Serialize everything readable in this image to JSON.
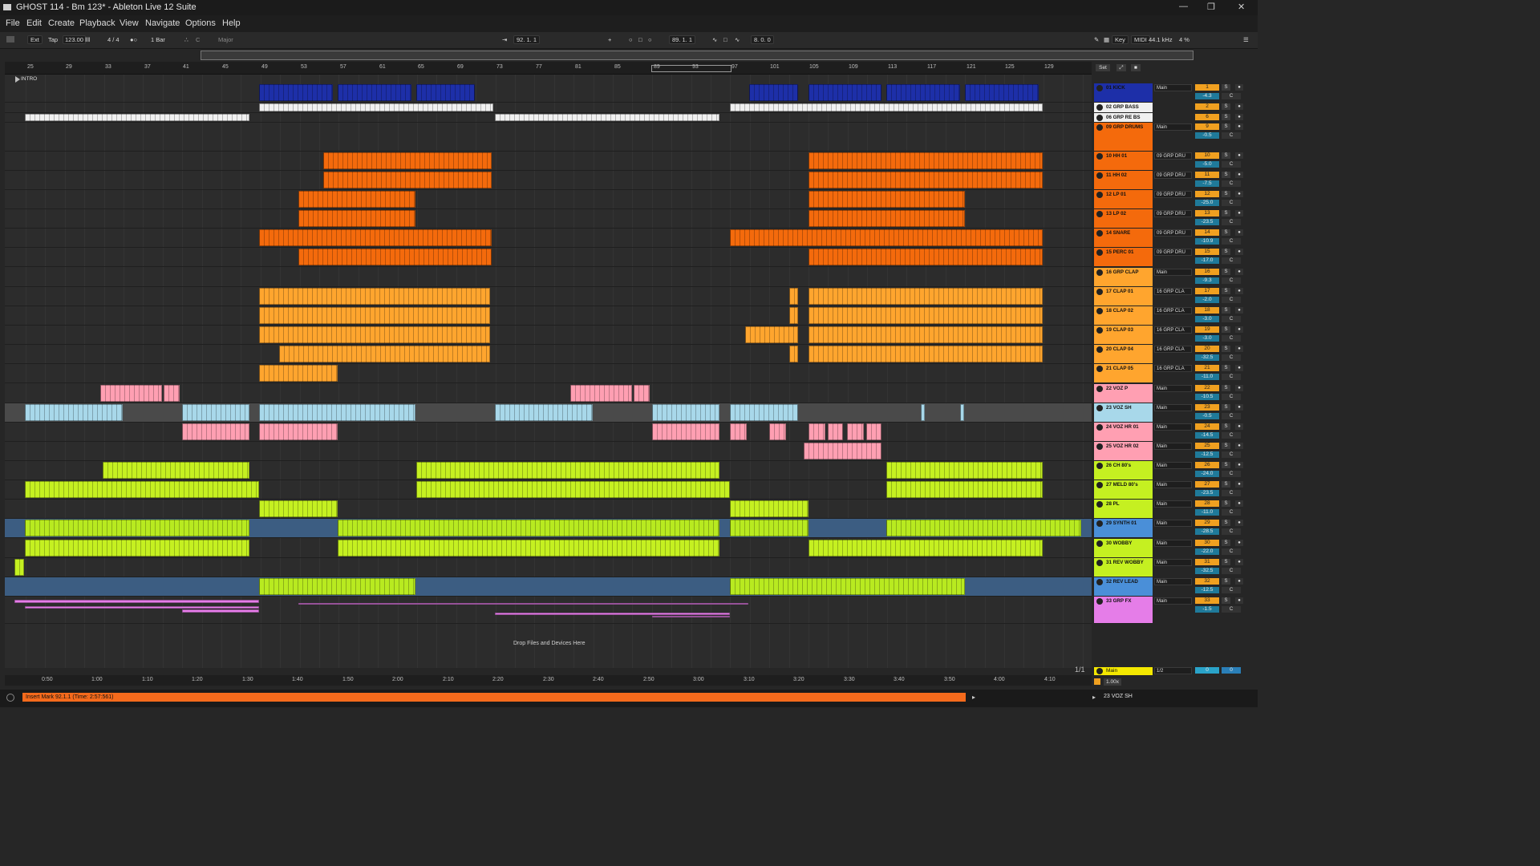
{
  "window": {
    "title": "GHOST 114 - Bm 123* - Ableton Live 12 Suite"
  },
  "menu": [
    "File",
    "Edit",
    "Create",
    "View",
    "Playback",
    "Navigate",
    "Options",
    "Help"
  ],
  "control": {
    "ext": "Ext",
    "tap": "Tap",
    "tempo": "123.00",
    "meter": "4 / 4",
    "quant": "1 Bar",
    "key": "C",
    "scale": "Major",
    "arr_pos": "92.  1.  1",
    "punch": "89.  1.  1",
    "loop_len": "8.  0.  0",
    "key_label": "Key",
    "midi_label": "MIDI",
    "sample_rate": "44.1 kHz",
    "cpu": "4 %"
  },
  "ruler": {
    "bars": [
      "25",
      "29",
      "33",
      "37",
      "41",
      "45",
      "49",
      "53",
      "57",
      "61",
      "65",
      "69",
      "73",
      "77",
      "81",
      "85",
      "89",
      "93",
      "97",
      "101",
      "105",
      "109",
      "113",
      "117",
      "121",
      "125",
      "129"
    ],
    "locator": "INTRO"
  },
  "timeline": {
    "times": [
      "0:50",
      "1:00",
      "1:10",
      "1:20",
      "1:30",
      "1:40",
      "1:50",
      "2:00",
      "2:10",
      "2:20",
      "2:30",
      "2:40",
      "2:50",
      "3:00",
      "3:10",
      "3:20",
      "3:30",
      "3:40",
      "3:50",
      "4:00",
      "4:10"
    ]
  },
  "tracks": [
    {
      "name": "01 KICK",
      "io": "Main",
      "num": "1",
      "vol": "-4.3",
      "color": "#1d2fa8"
    },
    {
      "name": "02 GRP BASS",
      "io": "",
      "num": "2",
      "vol": "",
      "color": "#f0f0f0"
    },
    {
      "name": "06 GRP RE BS",
      "io": "",
      "num": "6",
      "vol": "",
      "color": "#f0f0f0"
    },
    {
      "name": "09 GRP DRUMS",
      "io": "Main",
      "num": "9",
      "vol": "-0.5",
      "color": "#f46a0c"
    },
    {
      "name": "10 HH 01",
      "io": "09 GRP DRU",
      "num": "10",
      "vol": "-5.0",
      "color": "#f46a0c"
    },
    {
      "name": "11 HH 02",
      "io": "09 GRP DRU",
      "num": "11",
      "vol": "-7.5",
      "color": "#f46a0c"
    },
    {
      "name": "12 LP 01",
      "io": "09 GRP DRU",
      "num": "12",
      "vol": "-25.0",
      "color": "#f46a0c"
    },
    {
      "name": "13 LP 02",
      "io": "09 GRP DRU",
      "num": "13",
      "vol": "-23.5",
      "color": "#f46a0c"
    },
    {
      "name": "14 SNARE",
      "io": "09 GRP DRU",
      "num": "14",
      "vol": "-10.9",
      "color": "#f46a0c"
    },
    {
      "name": "15 PERC 01",
      "io": "09 GRP DRU",
      "num": "15",
      "vol": "-17.0",
      "color": "#f46a0c"
    },
    {
      "name": "16 GRP CLAP",
      "io": "Main",
      "num": "16",
      "vol": "-9.3",
      "color": "#ffa52e"
    },
    {
      "name": "17 CLAP 01",
      "io": "16 GRP CLA",
      "num": "17",
      "vol": "-2.0",
      "color": "#ffa52e"
    },
    {
      "name": "18 CLAP 02",
      "io": "16 GRP CLA",
      "num": "18",
      "vol": "-3.0",
      "color": "#ffa52e"
    },
    {
      "name": "19 CLAP 03",
      "io": "16 GRP CLA",
      "num": "19",
      "vol": "-3.0",
      "color": "#ffa52e"
    },
    {
      "name": "20 CLAP 04",
      "io": "16 GRP CLA",
      "num": "20",
      "vol": "-32.5",
      "color": "#ffa52e"
    },
    {
      "name": "21 CLAP 05",
      "io": "16 GRP CLA",
      "num": "21",
      "vol": "-11.0",
      "color": "#ffa52e"
    },
    {
      "name": "22 VOZ P",
      "io": "Main",
      "num": "22",
      "vol": "-10.5",
      "color": "#ff9fb2"
    },
    {
      "name": "23 VOZ SH",
      "io": "Main",
      "num": "23",
      "vol": "-0.5",
      "color": "#a8d8ea"
    },
    {
      "name": "24 VOZ HR 01",
      "io": "Main",
      "num": "24",
      "vol": "-14.5",
      "color": "#ff9fb2"
    },
    {
      "name": "25 VOZ HR 02",
      "io": "Main",
      "num": "25",
      "vol": "-12.5",
      "color": "#ff9fb2"
    },
    {
      "name": "26 CH 80's",
      "io": "Main",
      "num": "26",
      "vol": "-24.0",
      "color": "#c5f021"
    },
    {
      "name": "27 MELD 80's",
      "io": "Main",
      "num": "27",
      "vol": "-23.5",
      "color": "#c5f021"
    },
    {
      "name": "28 PL",
      "io": "Main",
      "num": "28",
      "vol": "-11.0",
      "color": "#c5f021"
    },
    {
      "name": "29 SYNTH 01",
      "io": "Main",
      "num": "29",
      "vol": "-28.5",
      "color": "#4a8fd8"
    },
    {
      "name": "30 WOBBY",
      "io": "Main",
      "num": "30",
      "vol": "-22.0",
      "color": "#c5f021"
    },
    {
      "name": "31 REV WOBBY",
      "io": "Main",
      "num": "31",
      "vol": "-32.5",
      "color": "#c5f021"
    },
    {
      "name": "32 REV LEAD",
      "io": "Main",
      "num": "32",
      "vol": "-12.5",
      "color": "#4a8fd8"
    },
    {
      "name": "33 GRP FX",
      "io": "Main",
      "num": "33",
      "vol": "-1.5",
      "color": "#e57de8"
    }
  ],
  "main_track": {
    "name": "Main",
    "io": "1/2",
    "num": "0",
    "vol": "0"
  },
  "set_label": "Set",
  "page_indicator": "1/1",
  "drop_hint": "Drop Files and Devices Here",
  "status": {
    "message": "Insert Mark 92.1.1 (Time: 2:57:561)",
    "selected_track": "23 VOZ SH",
    "zoom": "1.00x"
  }
}
